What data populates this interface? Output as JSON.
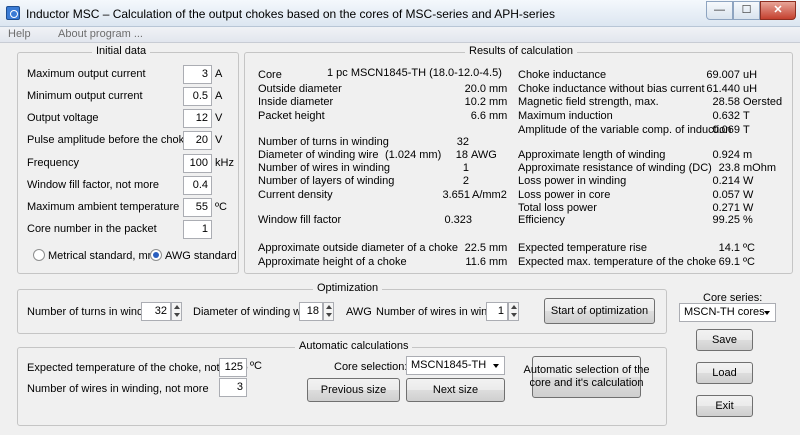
{
  "window": {
    "title": "Inductor MSC – Calculation of the output chokes based on the cores of MSC-series and APH-series",
    "min_glyph": "—",
    "max_glyph": "☐",
    "close_glyph": "✕"
  },
  "menu": {
    "help": "Help",
    "about": "About program ..."
  },
  "initial_data": {
    "title": "Initial data",
    "max_current": {
      "label": "Maximum output current",
      "value": "3",
      "unit": "A"
    },
    "min_current": {
      "label": "Minimum output current",
      "value": "0.5",
      "unit": "A"
    },
    "output_voltage": {
      "label": "Output voltage",
      "value": "12",
      "unit": "V"
    },
    "pulse_amplitude": {
      "label": "Pulse amplitude before the choke",
      "value": "20",
      "unit": "V"
    },
    "frequency": {
      "label": "Frequency",
      "value": "100",
      "unit": "kHz"
    },
    "window_fill": {
      "label": "Window fill factor, not more",
      "value": "0.4",
      "unit": ""
    },
    "ambient_temp": {
      "label": "Maximum ambient temperature",
      "value": "55",
      "unit": "ºC"
    },
    "core_number": {
      "label": "Core number in the packet",
      "value": "1",
      "unit": ""
    },
    "radio_metric": "Metrical standard, mm",
    "radio_awg": "AWG standard",
    "selected_standard": "AWG standard"
  },
  "results": {
    "title": "Results of calculation",
    "core": {
      "label": "Core",
      "value": "1 pc MSCN1845-TH (18.0-12.0-4.5)"
    },
    "outside_diameter": {
      "label": "Outside diameter",
      "value": "20.0",
      "unit": "mm"
    },
    "inside_diameter": {
      "label": "Inside diameter",
      "value": "10.2",
      "unit": "mm"
    },
    "packet_height": {
      "label": "Packet height",
      "value": "6.6",
      "unit": "mm"
    },
    "turns": {
      "label": "Number of turns in winding",
      "value": "32"
    },
    "wire_diameter": {
      "label": "Diameter of winding wire",
      "mm": "(1.024 mm)",
      "value": "18",
      "unit": "AWG"
    },
    "wires": {
      "label": "Number of wires in winding",
      "value": "1"
    },
    "layers": {
      "label": "Number of layers of winding",
      "value": "2"
    },
    "current_density": {
      "label": "Current density",
      "value": "3.651",
      "unit": "A/mm2"
    },
    "window_fill": {
      "label": "Window fill factor",
      "value": "0.323"
    },
    "approx_outside_diameter": {
      "label": "Approximate outside diameter of a choke",
      "value": "22.5",
      "unit": "mm"
    },
    "approx_height": {
      "label": "Approximate height of a choke",
      "value": "11.6",
      "unit": "mm"
    },
    "inductance": {
      "label": "Choke inductance",
      "value": "69.007",
      "unit": "uH"
    },
    "inductance_no_bias": {
      "label": "Choke inductance without bias current",
      "value": "61.440",
      "unit": "uH"
    },
    "field_strength": {
      "label": "Magnetic field strength, max.",
      "value": "28.58",
      "unit": "Oersted"
    },
    "max_induction": {
      "label": "Maximum induction",
      "value": "0.632",
      "unit": "T"
    },
    "variable_induction": {
      "label": "Amplitude of the variable comp. of induction",
      "value": "0.069",
      "unit": "T"
    },
    "winding_length": {
      "label": "Approximate length of winding",
      "value": "0.924",
      "unit": "m"
    },
    "winding_resistance": {
      "label": "Approximate resistance of winding (DC)",
      "value": "23.8",
      "unit": "mOhm"
    },
    "loss_winding": {
      "label": "Loss power in winding",
      "value": "0.214",
      "unit": "W"
    },
    "loss_core": {
      "label": "Loss power in core",
      "value": "0.057",
      "unit": "W"
    },
    "total_loss": {
      "label": "Total loss power",
      "value": "0.271",
      "unit": "W"
    },
    "efficiency": {
      "label": "Efficiency",
      "value": "99.25",
      "unit": "%"
    },
    "temp_rise": {
      "label": "Expected temperature rise",
      "value": "14.1",
      "unit": "ºC"
    },
    "max_temp": {
      "label": "Expected max. temperature of the choke",
      "value": "69.1",
      "unit": "ºC"
    }
  },
  "optimization": {
    "title": "Optimization",
    "turns_label": "Number of turns in winding",
    "turns_value": "32",
    "wire_label": "Diameter of winding wire",
    "wire_value": "18",
    "wire_unit": "AWG",
    "wires_label": "Number of wires in winding",
    "wires_value": "1",
    "start_button": "Start of optimization"
  },
  "auto": {
    "title": "Automatic calculations",
    "temp_label": "Expected temperature of the choke, not more",
    "temp_value": "125",
    "temp_unit": "ºC",
    "wires_label": "Number of wires in winding, not more",
    "wires_value": "3",
    "core_selection_label": "Core selection:",
    "core_selection_value": "MSCN1845-TH",
    "prev_button": "Previous size",
    "next_button": "Next size",
    "auto_button_line1": "Automatic selection of the",
    "auto_button_line2": "core and it's calculation"
  },
  "side": {
    "core_series_label": "Core series:",
    "core_series_value": "MSCN-TH cores",
    "save_button": "Save",
    "load_button": "Load",
    "exit_button": "Exit"
  }
}
